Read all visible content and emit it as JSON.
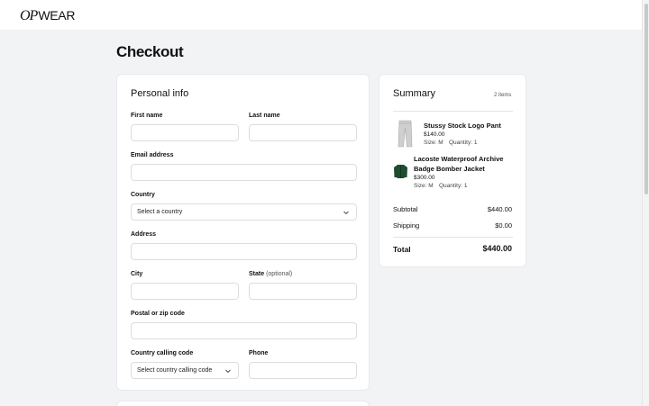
{
  "brand": {
    "logo_script": "OP",
    "logo_rest": "WEAR"
  },
  "page": {
    "title": "Checkout"
  },
  "personal_info": {
    "title": "Personal info",
    "first_name": {
      "label": "First name",
      "value": ""
    },
    "last_name": {
      "label": "Last name",
      "value": ""
    },
    "email": {
      "label": "Email address",
      "value": ""
    },
    "country": {
      "label": "Country",
      "value": "Select a country"
    },
    "address": {
      "label": "Address",
      "value": ""
    },
    "city": {
      "label": "City",
      "value": ""
    },
    "state": {
      "label": "State",
      "optional": "(optional)",
      "value": ""
    },
    "postal": {
      "label": "Postal or zip code",
      "value": ""
    },
    "calling_code": {
      "label": "Country calling code",
      "value": "Select country calling code"
    },
    "phone": {
      "label": "Phone",
      "value": ""
    }
  },
  "summary": {
    "title": "Summary",
    "count": "2 items",
    "items": [
      {
        "name": "Stussy Stock Logo Pant",
        "price": "$140.00",
        "size": "Size: M",
        "quantity": "Quantity: 1",
        "image": "grey-pants-icon"
      },
      {
        "name_line1": "Lacoste Waterproof Archive",
        "name_line2": "Badge Bomber Jacket",
        "price": "$300.00",
        "size": "Size: M",
        "quantity": "Quantity: 1",
        "image": "green-jacket-icon"
      }
    ],
    "subtotal_label": "Subtotal",
    "subtotal_value": "$440.00",
    "shipping_label": "Shipping",
    "shipping_value": "$0.00",
    "total_label": "Total",
    "total_value": "$440.00"
  },
  "colors": {
    "background": "#f2f3f5",
    "card": "#ffffff",
    "border": "#dcdde1",
    "jacket": "#1f4d2f",
    "pants": "#cfcfcf"
  }
}
